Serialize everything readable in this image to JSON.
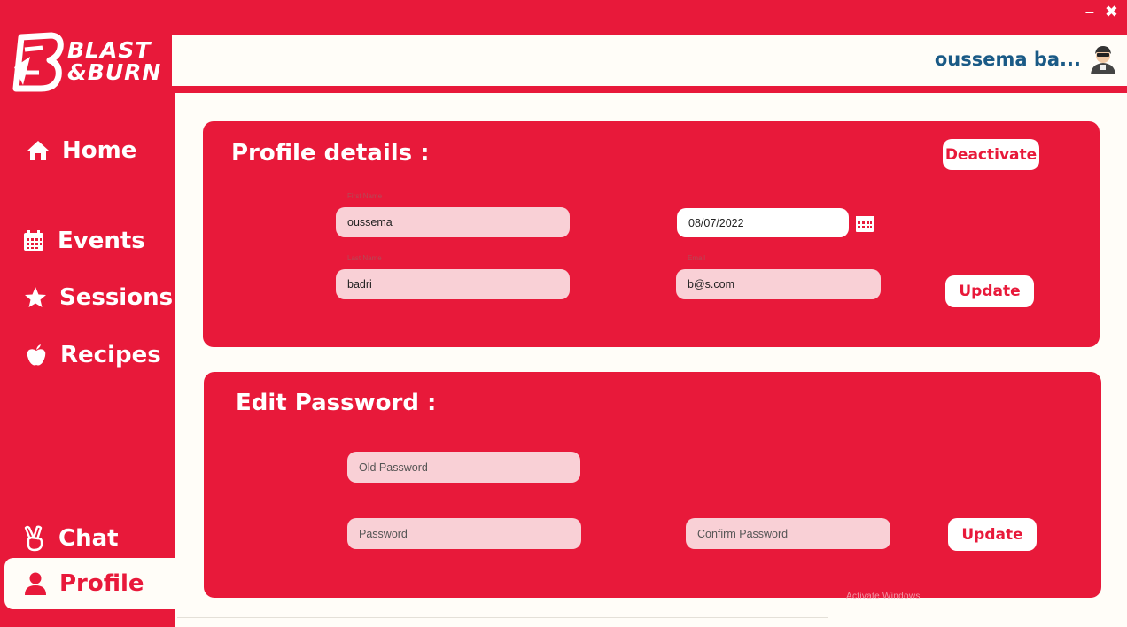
{
  "window": {
    "minimize_glyph": "–",
    "close_glyph": "✖"
  },
  "brand": {
    "line1": "BLAST",
    "line2": "&BURN",
    "color": "#e8193a"
  },
  "header": {
    "user_name": "oussema  ba..."
  },
  "sidebar": {
    "items": [
      {
        "label": "Home",
        "icon": "home-icon"
      },
      {
        "label": "Events",
        "icon": "calendar-icon"
      },
      {
        "label": "Sessions",
        "icon": "star-icon"
      },
      {
        "label": "Recipes",
        "icon": "apple-icon"
      },
      {
        "label": "Chat",
        "icon": "peace-hand-icon"
      },
      {
        "label": "Profile",
        "icon": "user-icon",
        "active": true
      }
    ]
  },
  "profile": {
    "title": "Profile details :",
    "deactivate_label": "Deactivate",
    "first_name_label": "First Name",
    "first_name": "oussema",
    "birth_date": "08/07/2022",
    "last_name_label": "Last Name",
    "last_name": "badri",
    "email_label": "Email",
    "email": "b@s.com",
    "update_label": "Update"
  },
  "password": {
    "title": "Edit Password :",
    "old_placeholder": "Old Password",
    "new_placeholder": "Password",
    "confirm_placeholder": "Confirm Password",
    "update_label": "Update"
  },
  "watermark": "Activate Windows"
}
